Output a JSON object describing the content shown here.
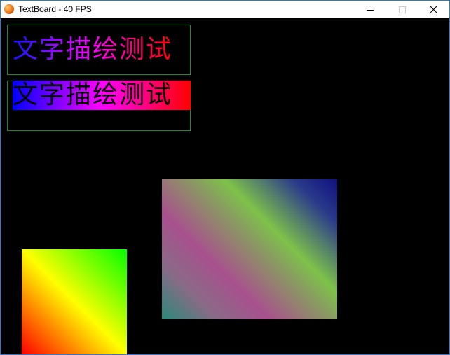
{
  "window": {
    "title": "TextBoard - 40 FPS",
    "buttons": {
      "minimize": "minimize-icon",
      "maximize": "maximize-icon",
      "close": "close-icon"
    },
    "border_color": "#2b7bd6"
  },
  "canvas": {
    "background": "#000000",
    "box_border_color": "#1f8a2a",
    "text_gradient_sample": {
      "text": "文字描绘测试",
      "gradient_colors": [
        "#1414ff",
        "#ff00ff",
        "#ff0000"
      ]
    },
    "text_background_sample": {
      "text": "文字描绘测试",
      "text_color": "#000000",
      "gradient_colors": [
        "#0000ff",
        "#ff00ff",
        "#ff0000"
      ]
    },
    "large_gradient_rect": {
      "colors": [
        "#101080",
        "#7ec24a",
        "#a8508e",
        "#2a8a7a"
      ]
    },
    "small_gradient_rect": {
      "colors": [
        "#00ff00",
        "#ffff00",
        "#ff0000"
      ]
    }
  }
}
